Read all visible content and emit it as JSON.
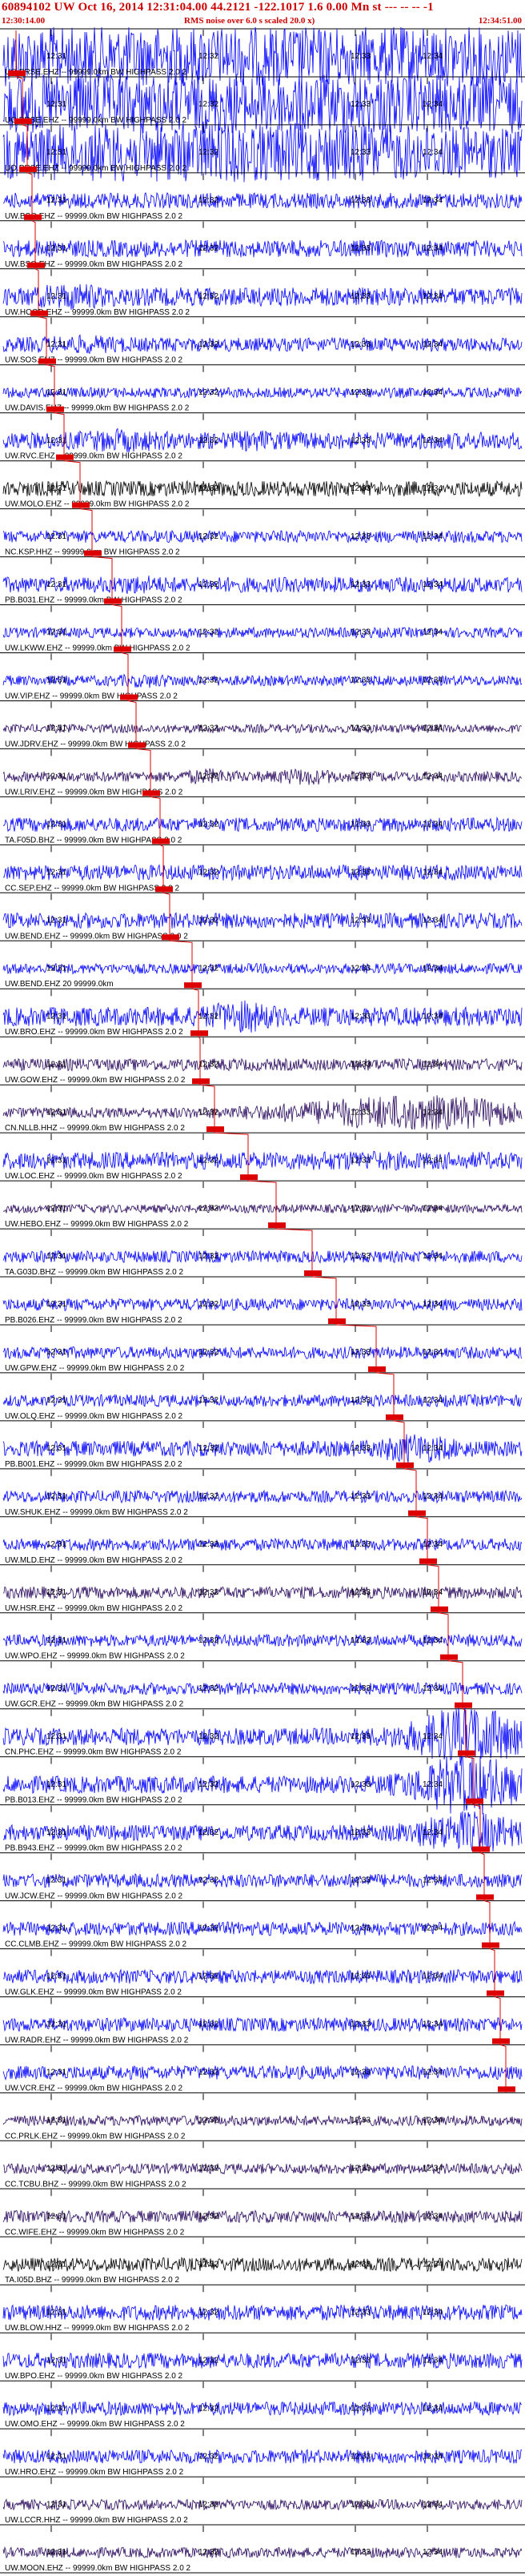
{
  "header": {
    "title": "60894102 UW Oct 16, 2014 12:31:04.00    44.2121 -122.1017   1.6 0.00 Mn st --- -- -- -1",
    "start_time": "12:30:14.00",
    "end_time": "12:34:51.00",
    "rms_note": "RMS noise over 6.0 s scaled 20.0 x)"
  },
  "tick_labels": [
    "12:31",
    "12:32",
    "12:33",
    "12:34"
  ],
  "colors": {
    "trace_blue": "#0000ff",
    "trace_dark": "#2a0a5e",
    "trace_black": "#000000",
    "pick_red": "#dd0000",
    "separator": "#000000"
  },
  "traces": [
    {
      "label": "UO.PRSE.EHZ -- 99999.0km BW  HIGHPASS  2.0  2",
      "color": "blue"
    },
    {
      "label": "UO.PRSE.EHZ -- 99999.0km BW  HIGHPASS  2.0  2",
      "color": "blue"
    },
    {
      "label": "UO.PRSE.EHZ -- 99999.0km BW  HIGHPASS  2.0  2",
      "color": "blue"
    },
    {
      "label": "UW.BSO.EHZ -- 99999.0km BW  HIGHPASS  2.0  2",
      "color": "blue"
    },
    {
      "label": "UW.BSO.EHZ -- 99999.0km BW  HIGHPASS  2.0  2",
      "color": "blue"
    },
    {
      "label": "UW.HOOD.EHZ -- 99999.0km BW  HIGHPASS  2.0  2",
      "color": "blue"
    },
    {
      "label": "UW.SOS.EHZ -- 99999.0km BW  HIGHPASS  2.0  2",
      "color": "blue"
    },
    {
      "label": "UW.DAVIS.EHZ -- 99999.0km BW  HIGHPASS  2.0  2",
      "color": "blue"
    },
    {
      "label": "UW.RVC.EHZ -- 99999.0km BW  HIGHPASS  2.0  2",
      "color": "blue"
    },
    {
      "label": "UW.MOLO.EHZ -- 99999.0km BW  HIGHPASS  2.0  2",
      "color": "black"
    },
    {
      "label": "NC.KSP.HHZ -- 99999.0km BW  HIGHPASS  2.0  2",
      "color": "blue"
    },
    {
      "label": "PB.B031.EHZ -- 99999.0km BW  HIGHPASS  2.0  2",
      "color": "blue"
    },
    {
      "label": "UW.LKWW.EHZ -- 99999.0km BW  HIGHPASS  2.0  2",
      "color": "blue"
    },
    {
      "label": "UW.VIP.EHZ -- 99999.0km BW  HIGHPASS  2.0  2",
      "color": "blue"
    },
    {
      "label": "UW.JDRV.EHZ -- 99999.0km BW  HIGHPASS  2.0  2",
      "color": "dark"
    },
    {
      "label": "UW.LRIV.EHZ -- 99999.0km BW  HIGHPASS  2.0  2",
      "color": "dark"
    },
    {
      "label": "TA.F05D.BHZ -- 99999.0km BW  HIGHPASS  2.0  2",
      "color": "blue"
    },
    {
      "label": "CC.SEP.EHZ -- 99999.0km BW  HIGHPASS  2.0  2",
      "color": "blue"
    },
    {
      "label": "UW.BEND.EHZ -- 99999.0km BW  HIGHPASS  2.0  2",
      "color": "blue"
    },
    {
      "label": "UW.BEND.EHZ 20 99999.0km",
      "color": "blue"
    },
    {
      "label": "UW.BRO.EHZ -- 99999.0km BW  HIGHPASS  2.0  2",
      "color": "blue"
    },
    {
      "label": "UW.GOW.EHZ -- 99999.0km BW  HIGHPASS  2.0  2",
      "color": "dark"
    },
    {
      "label": "CN.NLLB.HHZ -- 99999.0km BW  HIGHPASS  2.0  2",
      "color": "dark"
    },
    {
      "label": "UW.LOC.EHZ -- 99999.0km BW  HIGHPASS  2.0  2",
      "color": "blue"
    },
    {
      "label": "UW.HEBO.EHZ -- 99999.0km BW  HIGHPASS  2.0  2",
      "color": "dark"
    },
    {
      "label": "TA.G03D.BHZ -- 99999.0km BW  HIGHPASS  2.0  2",
      "color": "blue"
    },
    {
      "label": "PB.B026.EHZ -- 99999.0km BW  HIGHPASS  2.0  2",
      "color": "blue"
    },
    {
      "label": "UW.GPW.EHZ -- 99999.0km BW  HIGHPASS  2.0  2",
      "color": "blue"
    },
    {
      "label": "UW.OLQ.EHZ -- 99999.0km BW  HIGHPASS  2.0  2",
      "color": "blue"
    },
    {
      "label": "PB.B001.EHZ -- 99999.0km BW  HIGHPASS  2.0  2",
      "color": "blue"
    },
    {
      "label": "UW.SHUK.EHZ -- 99999.0km BW  HIGHPASS  2.0  2",
      "color": "blue"
    },
    {
      "label": "UW.MLD.EHZ -- 99999.0km BW  HIGHPASS  2.0  2",
      "color": "blue"
    },
    {
      "label": "UW.HSR.EHZ -- 99999.0km BW  HIGHPASS  2.0  2",
      "color": "dark"
    },
    {
      "label": "UW.WPO.EHZ -- 99999.0km BW  HIGHPASS  2.0  2",
      "color": "blue"
    },
    {
      "label": "UW.GCR.EHZ -- 99999.0km BW  HIGHPASS  2.0  2",
      "color": "blue"
    },
    {
      "label": "CN.PHC.EHZ -- 99999.0km BW  HIGHPASS  2.0  2",
      "color": "blue"
    },
    {
      "label": "PB.B013.EHZ -- 99999.0km BW  HIGHPASS  2.0  2",
      "color": "blue"
    },
    {
      "label": "PB.B943.EHZ -- 99999.0km BW  HIGHPASS  2.0  2",
      "color": "blue"
    },
    {
      "label": "UW.JCW.EHZ -- 99999.0km BW  HIGHPASS  2.0  2",
      "color": "blue"
    },
    {
      "label": "CC.CLMB.EHZ -- 99999.0km BW  HIGHPASS  2.0  2",
      "color": "blue"
    },
    {
      "label": "UW.GLK.EHZ -- 99999.0km BW  HIGHPASS  2.0  2",
      "color": "blue"
    },
    {
      "label": "UW.RADR.EHZ -- 99999.0km BW  HIGHPASS  2.0  2",
      "color": "blue"
    },
    {
      "label": "UW.VCR.EHZ -- 99999.0km BW  HIGHPASS  2.0  2",
      "color": "blue"
    },
    {
      "label": "CC.PRLK.EHZ -- 99999.0km BW  HIGHPASS  2.0  2",
      "color": "dark"
    },
    {
      "label": "CC.TCBU.BHZ -- 99999.0km BW  HIGHPASS  2.0  2",
      "color": "dark"
    },
    {
      "label": "CC.WIFE.EHZ -- 99999.0km BW  HIGHPASS  2.0  2",
      "color": "dark"
    },
    {
      "label": "TA.I05D.BHZ -- 99999.0km BW  HIGHPASS  2.0  2",
      "color": "black"
    },
    {
      "label": "UW.BLOW.HHZ -- 99999.0km BW  HIGHPASS  2.0  2",
      "color": "blue"
    },
    {
      "label": "UW.BPO.EHZ -- 99999.0km BW  HIGHPASS  2.0  2",
      "color": "blue"
    },
    {
      "label": "UW.OMO.EHZ -- 99999.0km BW  HIGHPASS  2.0  2",
      "color": "blue"
    },
    {
      "label": "UW.HRO.EHZ -- 99999.0km BW  HIGHPASS  2.0  2",
      "color": "blue"
    },
    {
      "label": "UW.LCCR.HHZ -- 99999.0km BW  HIGHPASS  2.0  2",
      "color": "dark"
    },
    {
      "label": "UW.MOON.EHZ -- 99999.0km BW  HIGHPASS  2.0  2",
      "color": "dark"
    }
  ]
}
